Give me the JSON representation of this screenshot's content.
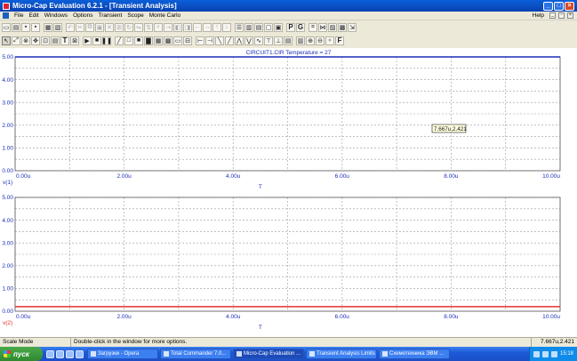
{
  "window": {
    "title": "Micro-Cap Evaluation 6.2.1 - [Transient Analysis]",
    "controls": [
      "_",
      "□",
      "×"
    ]
  },
  "menu": {
    "items": [
      "File",
      "Edit",
      "Windows",
      "Options",
      "Transient",
      "Scope",
      "Monte Carlo"
    ],
    "help": "Help"
  },
  "toolbar1": {
    "letters": [
      "P",
      "G"
    ]
  },
  "toolbar2": {
    "text_tool": "T",
    "font_button": "F"
  },
  "plot": {
    "title": "CIRCUIT1.CIR Temperature = 27",
    "cursor_readout": "7.667u,2.421",
    "accent_blue": "#1c2fb8",
    "trace_red": "#e8312a",
    "panes": [
      {
        "y_label": "v(1)",
        "x_label": "T",
        "y_ticks": [
          "5.00",
          "4.00",
          "3.00",
          "2.00",
          "1.00",
          "0.00"
        ],
        "x_ticks": [
          "0.00u",
          "2.00u",
          "4.00u",
          "6.00u",
          "8.00u",
          "10.00u"
        ]
      },
      {
        "y_label": "v(2)",
        "x_label": "T",
        "y_ticks": [
          "5.00",
          "4.00",
          "3.00",
          "2.00",
          "1.00",
          "0.00"
        ],
        "x_ticks": [
          "0.00u",
          "2.00u",
          "4.00u",
          "6.00u",
          "8.00u",
          "10.00u"
        ]
      }
    ]
  },
  "chart_data": [
    {
      "type": "line",
      "xlabel": "T",
      "ylabel": "v(1)",
      "xlim": [
        0,
        10
      ],
      "ylim": [
        0,
        5
      ],
      "x_unit": "u",
      "grid": true,
      "series": [
        {
          "name": "v(1)",
          "x": [
            0,
            10
          ],
          "y": [
            5.0,
            5.0
          ],
          "color": "#1c2fb8"
        }
      ]
    },
    {
      "type": "line",
      "xlabel": "T",
      "ylabel": "v(2)",
      "xlim": [
        0,
        10
      ],
      "ylim": [
        0,
        5
      ],
      "x_unit": "u",
      "grid": true,
      "series": [
        {
          "name": "v(2)",
          "x": [
            0,
            10
          ],
          "y": [
            0.2,
            0.2
          ],
          "color": "#e8312a"
        }
      ]
    }
  ],
  "status": {
    "mode": "Scale Mode",
    "hint": "Double-click in the window for more options.",
    "coords": "7.667u,2.421"
  },
  "taskbar": {
    "start": "пуск",
    "tasks": [
      "Загрузки - Opera",
      "Total Commander 7.0...",
      "Micro-Cap Evaluation ...",
      "Transient Analysis Limits",
      "Схемотехника ЭВМ ..."
    ],
    "clock": "15:18"
  }
}
